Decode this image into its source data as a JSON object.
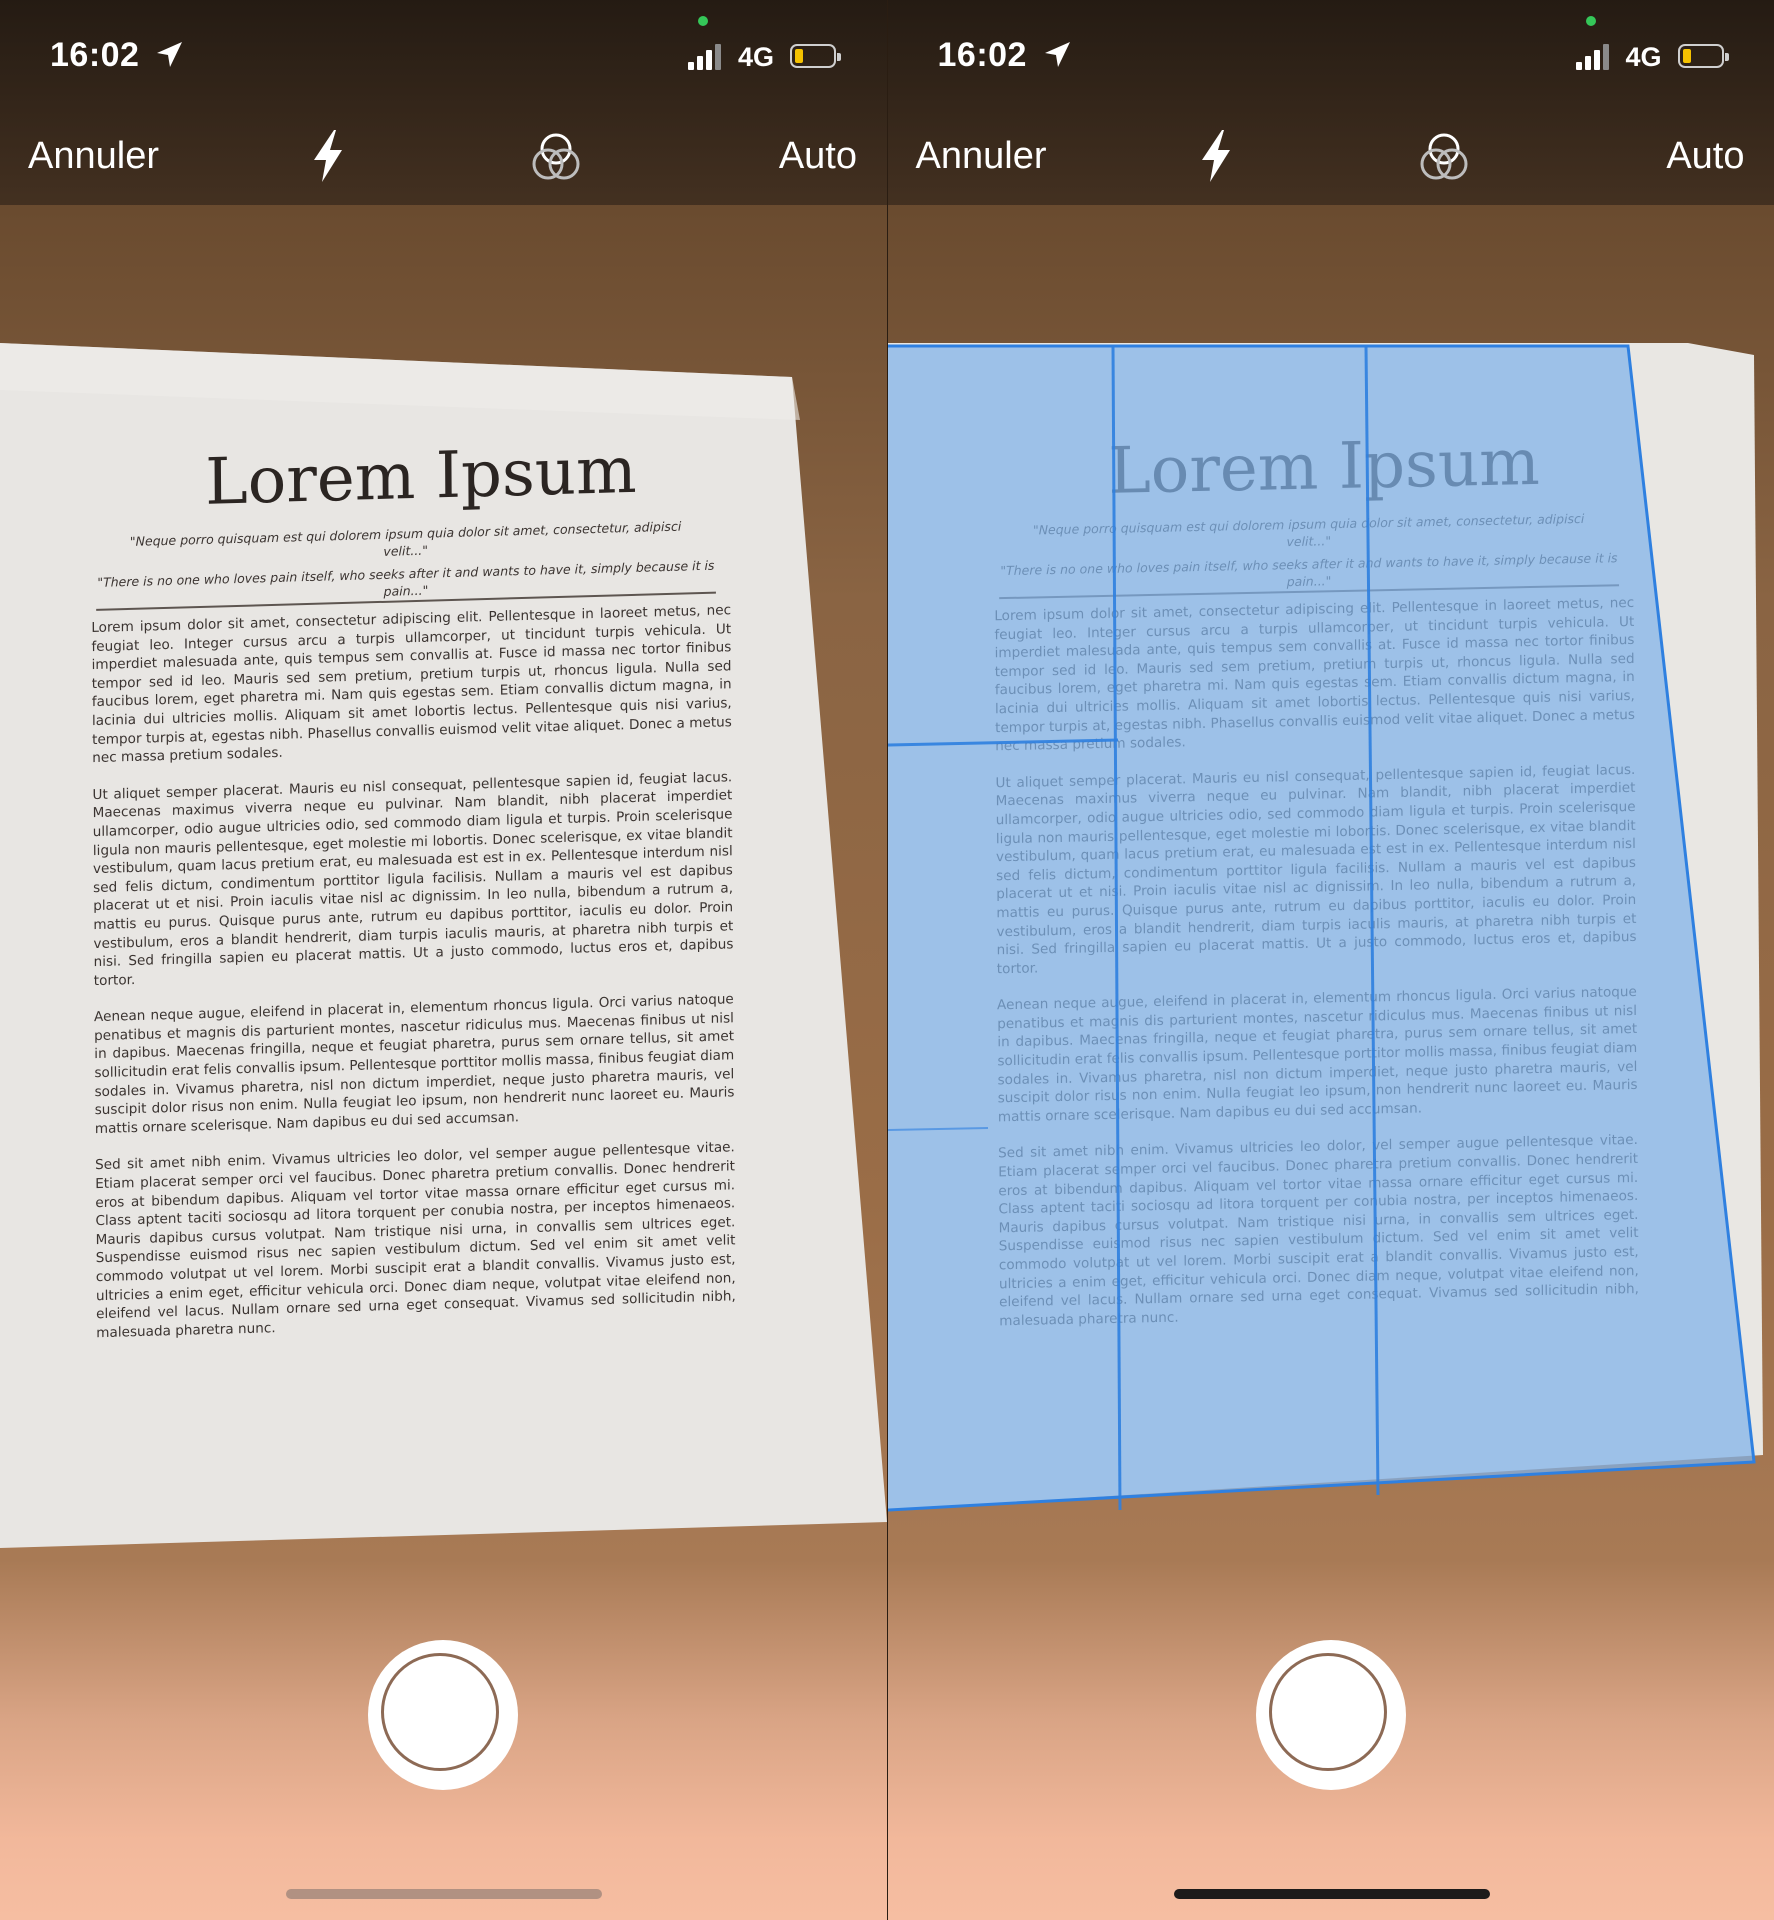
{
  "status_bar": {
    "time": "16:02",
    "network": "4G"
  },
  "toolbar": {
    "cancel_label": "Annuler",
    "mode_label": "Auto"
  },
  "document": {
    "title": "Lorem Ipsum",
    "quote1": "\"Neque porro quisquam est qui dolorem ipsum quia dolor sit amet, consectetur, adipisci velit...\"",
    "quote2": "\"There is no one who loves pain itself, who seeks after it and wants to have it, simply because it is pain...\"",
    "paragraphs": [
      "Lorem ipsum dolor sit amet, consectetur adipiscing elit. Pellentesque in laoreet metus, nec feugiat leo. Integer cursus arcu a turpis ullamcorper, ut tincidunt turpis vehicula. Ut imperdiet malesuada ante, quis tempus sem convallis at. Fusce id massa nec tortor finibus tempor sed id leo. Mauris sed sem pretium, pretium turpis ut, rhoncus ligula. Nulla sed faucibus lorem, eget pharetra mi. Nam quis egestas sem. Etiam convallis dictum magna, in lacinia dui ultricies mollis. Aliquam sit amet lobortis lectus. Pellentesque quis nisi varius, tempor turpis at, egestas nibh. Phasellus convallis euismod velit vitae aliquet. Donec a metus nec massa pretium sodales.",
      "Ut aliquet semper placerat. Mauris eu nisl consequat, pellentesque sapien id, feugiat lacus. Maecenas maximus viverra neque eu pulvinar. Nam blandit, nibh placerat imperdiet ullamcorper, odio augue ultricies odio, sed commodo diam ligula et turpis. Proin scelerisque ligula non mauris pellentesque, eget molestie mi lobortis. Donec scelerisque, ex vitae blandit vestibulum, quam lacus pretium erat, eu malesuada est est in ex. Pellentesque interdum nisl sed felis dictum, condimentum porttitor ligula facilisis. Nullam a mauris vel est dapibus placerat ut et nisi. Proin iaculis vitae nisl ac dignissim. In leo nulla, bibendum a rutrum a, mattis eu purus. Quisque purus ante, rutrum eu dapibus porttitor, iaculis eu dolor. Proin vestibulum, eros a blandit hendrerit, diam turpis iaculis mauris, at pharetra nibh turpis et nisi. Sed fringilla sapien eu placerat mattis. Ut a justo commodo, luctus eros et, dapibus tortor.",
      "Aenean neque augue, eleifend in placerat in, elementum rhoncus ligula. Orci varius natoque penatibus et magnis dis parturient montes, nascetur ridiculus mus. Maecenas finibus ut nisl in dapibus. Maecenas fringilla, neque et feugiat pharetra, purus sem ornare tellus, sit amet sollicitudin erat felis convallis ipsum. Pellentesque porttitor mollis massa, finibus feugiat diam sodales in. Vivamus pharetra, nisl non dictum imperdiet, neque justo pharetra mauris, vel suscipit dolor risus non enim. Nulla feugiat leo ipsum, non hendrerit nunc laoreet eu. Mauris mattis ornare scelerisque. Nam dapibus eu dui sed accumsan.",
      "Sed sit amet nibh enim. Vivamus ultricies leo dolor, vel semper augue pellentesque vitae. Etiam placerat semper orci vel faucibus. Donec pharetra pretium convallis. Donec hendrerit eros at bibendum dapibus. Aliquam vel tortor vitae massa ornare efficitur eget cursus mi. Class aptent taciti sociosqu ad litora torquent per conubia nostra, per inceptos himenaeos. Mauris dapibus cursus volutpat. Nam tristique nisi urna, in convallis sem ultrices eget. Suspendisse euismod risus nec sapien vestibulum dictum. Sed vel enim sit amet velit commodo volutpat ut vel lorem. Morbi suscipit erat a blandit convallis. Vivamus justo est, ultricies a enim eget, efficitur vehicula orci. Donec diam neque, volutpat vitae eleifend non, eleifend vel lacus. Nullam ornare sed urna eget consequat. Vivamus sed sollicitudin nibh, malesuada pharetra nunc."
    ]
  },
  "colors": {
    "detection_overlay": "#8ab8e6",
    "detection_edge": "#2f80e0",
    "battery_fill": "#f5c200",
    "mic_indicator": "#35c759"
  },
  "icons": {
    "location": "location-arrow-icon",
    "signal": "cellular-signal-icon",
    "battery": "battery-low-icon",
    "flash": "flash-icon",
    "filter": "color-filter-icon",
    "shutter": "shutter-button"
  }
}
